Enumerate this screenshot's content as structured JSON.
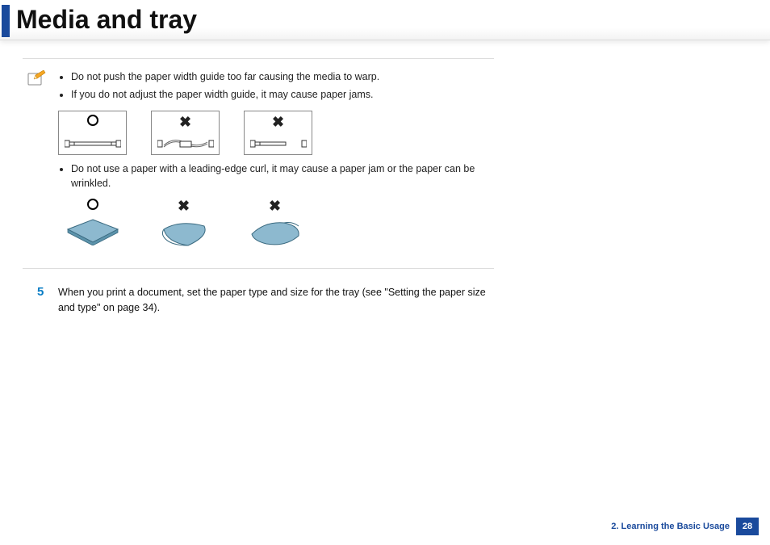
{
  "header": {
    "title": "Media and tray"
  },
  "note": {
    "bullets": [
      "Do not push the paper width guide too far causing the media to warp.",
      "If you do not adjust the paper width guide, it may cause paper jams."
    ],
    "curl_bullet": "Do not use a paper with a leading-edge curl, it may cause a paper jam or the paper can be wrinkled."
  },
  "step": {
    "number": "5",
    "text": "When you print a document, set the paper type and size for the tray (see \"Setting the paper size and type\" on page 34)."
  },
  "footer": {
    "chapter": "2. Learning the Basic Usage",
    "page": "28"
  },
  "marks": {
    "ok": "○",
    "bad": "✖"
  }
}
